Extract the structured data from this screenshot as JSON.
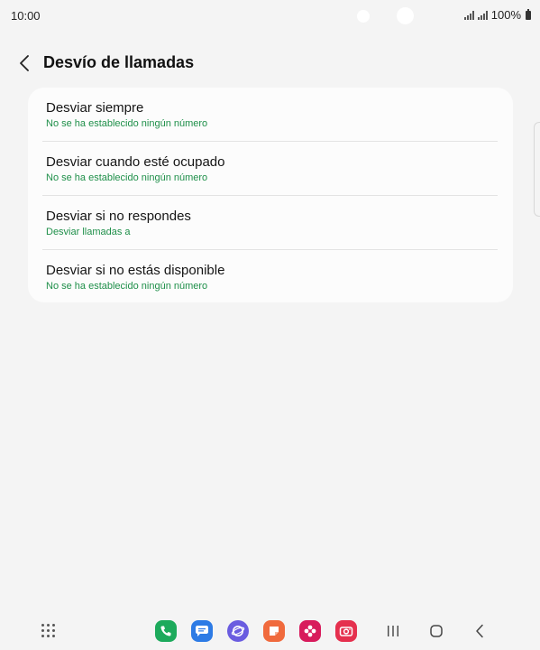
{
  "status_bar": {
    "time": "10:00",
    "battery": "100%"
  },
  "header": {
    "title": "Desvío de llamadas",
    "back_icon": "chevron-left-icon"
  },
  "settings": [
    {
      "title": "Desviar siempre",
      "subtitle": "No se ha establecido ningún número"
    },
    {
      "title": "Desviar cuando esté ocupado",
      "subtitle": "No se ha establecido ningún número"
    },
    {
      "title": "Desviar si no respondes",
      "subtitle": "Desviar llamadas a"
    },
    {
      "title": "Desviar si no estás disponible",
      "subtitle": "No se ha establecido ningún número"
    }
  ],
  "colors": {
    "accent": "#1e8f49",
    "background": "#f4f4f4",
    "card": "#fcfcfc"
  },
  "dock": {
    "apps": [
      {
        "name": "phone-icon",
        "color": "#1daa5c"
      },
      {
        "name": "messages-icon",
        "color": "#2d7be5"
      },
      {
        "name": "internet-icon",
        "color": "#6a5ce0"
      },
      {
        "name": "notes-icon",
        "color": "#f06a3d"
      },
      {
        "name": "gallery-icon",
        "color": "#d81b5c"
      },
      {
        "name": "camera-icon",
        "color": "#e5304e"
      }
    ],
    "nav": [
      "recents-icon",
      "home-icon",
      "back-nav-icon"
    ]
  }
}
